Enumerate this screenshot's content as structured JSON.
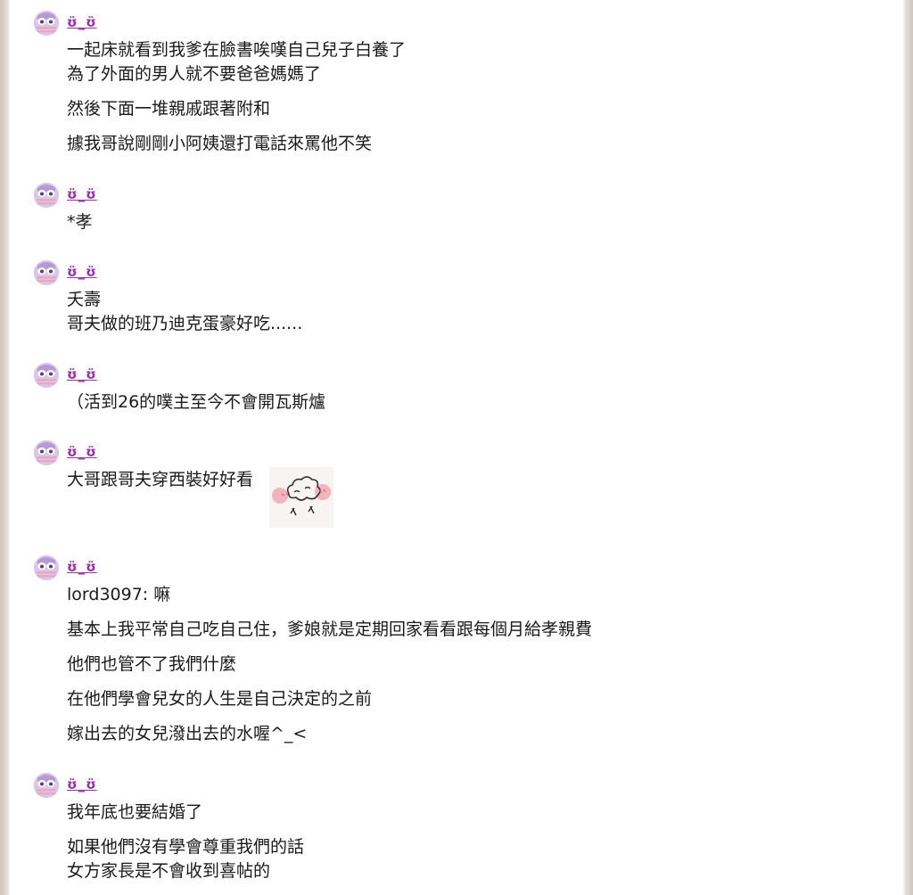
{
  "author": {
    "name": "ʊ̈_ʊ̈"
  },
  "posts": [
    {
      "paragraphs": [
        [
          "一起床就看到我爹在臉書唉嘆自己兒子白養了",
          "為了外面的男人就不要爸爸媽媽了"
        ],
        [
          "然後下面一堆親戚跟著附和"
        ],
        [
          "據我哥說剛剛小阿姨還打電話來罵他不笑"
        ]
      ]
    },
    {
      "paragraphs": [
        [
          "*孝"
        ]
      ]
    },
    {
      "paragraphs": [
        [
          "夭壽",
          "哥夫做的班乃迪克蛋豪好吃......"
        ]
      ]
    },
    {
      "paragraphs": [
        [
          "（活到26的噗主至今不會開瓦斯爐"
        ]
      ]
    },
    {
      "paragraphs": [
        [
          "大哥跟哥夫穿西裝好好看"
        ]
      ],
      "sticker": "blushing-cloud-sticker"
    },
    {
      "paragraphs": [
        [
          "lord3097: 嘛"
        ],
        [
          "基本上我平常自己吃自己住，爹娘就是定期回家看看跟每個月給孝親費"
        ],
        [
          "他們也管不了我們什麼"
        ],
        [
          "在他們學會兒女的人生是自己決定的之前"
        ],
        [
          "嫁出去的女兒潑出去的水喔^_<"
        ]
      ]
    },
    {
      "paragraphs": [
        [
          "我年底也要結婚了"
        ],
        [
          "如果他們沒有學會尊重我們的話",
          "女方家長是不會收到喜帖的"
        ]
      ]
    }
  ],
  "colors": {
    "username": "#9b2fae",
    "text": "#1a1a1a",
    "avatar_bg": "#d8c7ea"
  }
}
